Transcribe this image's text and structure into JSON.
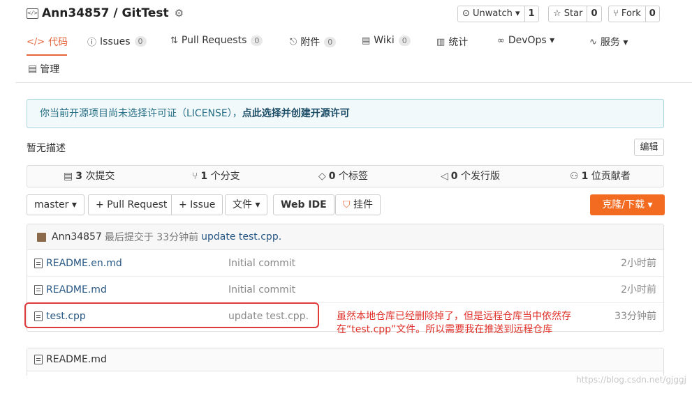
{
  "header": {
    "repo_name": "Ann34857 / GitTest",
    "watch_label": "⊙ Unwatch ▾",
    "watch_count": "1",
    "star_label": "☆ Star",
    "star_count": "0",
    "fork_label": "⑂ Fork",
    "fork_count": "0"
  },
  "tabs": [
    {
      "label": "代码",
      "count": null
    },
    {
      "label": "Issues",
      "count": "0"
    },
    {
      "label": "Pull Requests",
      "count": "0"
    },
    {
      "label": "附件",
      "count": "0"
    },
    {
      "label": "Wiki",
      "count": "0"
    },
    {
      "label": "统计",
      "count": null
    },
    {
      "label": "DevOps ▾",
      "count": null
    },
    {
      "label": "服务 ▾",
      "count": null
    },
    {
      "label": "管理",
      "count": null
    }
  ],
  "notice": {
    "text": "你当前开源项目尚未选择许可证（LICENSE），",
    "link": "点此选择并创建开源许可"
  },
  "description": "暂无描述",
  "edit_label": "编辑",
  "stats": {
    "commits_num": "3",
    "commits_label": "次提交",
    "branches_num": "1",
    "branches_label": "个分支",
    "tags_num": "0",
    "tags_label": "个标签",
    "releases_num": "0",
    "releases_label": "个发行版",
    "contributors_num": "1",
    "contributors_label": "位贡献者"
  },
  "actions": {
    "branch": "master ▾",
    "pull_request": "+ Pull Request",
    "issue": "+ Issue",
    "file": "文件 ▾",
    "web_ide": "Web IDE",
    "pin": "挂件",
    "clone": "克隆/下载 ▾"
  },
  "latest_commit": {
    "author": "Ann34857",
    "text": "最后提交于 33分钟前",
    "message": "update test.cpp."
  },
  "files": [
    {
      "name": "README.en.md",
      "message": "Initial commit",
      "time": "2小时前"
    },
    {
      "name": "README.md",
      "message": "Initial commit",
      "time": "2小时前"
    },
    {
      "name": "test.cpp",
      "message": "update test.cpp.",
      "time": "33分钟前"
    }
  ],
  "annotation": "虽然本地仓库已经删除掉了，但是远程仓库当中依然存在“test.cpp”文件。所以需要我在推送到远程仓库",
  "readme_title": "README.md",
  "watermark": "https://blog.csdn.net/gjggj",
  "colors": {
    "accent": "#e6653b",
    "clone": "#f26b21",
    "annotation": "#e0322a"
  }
}
